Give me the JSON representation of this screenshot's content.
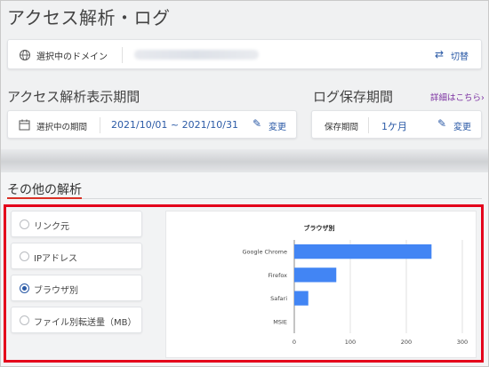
{
  "page": {
    "title": "アクセス解析・ログ"
  },
  "domain": {
    "label": "選択中のドメイン",
    "switch_label": "切替",
    "icon": "globe-icon"
  },
  "period": {
    "heading": "アクセス解析表示期間",
    "label": "選択中の期間",
    "value": "2021/10/01 ~ 2021/10/31",
    "edit_label": "変更"
  },
  "log": {
    "heading": "ログ保存期間",
    "detail_link": "詳細はこちら›",
    "label": "保存期間",
    "value": "1ケ月",
    "edit_label": "変更"
  },
  "other": {
    "heading": "その他の解析",
    "options": [
      {
        "label": "リンク元",
        "selected": false
      },
      {
        "label": "IPアドレス",
        "selected": false
      },
      {
        "label": "ブラウザ別",
        "selected": true
      },
      {
        "label": "ファイル別転送量（MB）",
        "selected": false
      }
    ]
  },
  "colors": {
    "accent": "#2b5aa6",
    "highlight": "#e4001b",
    "bar": "#4285f4"
  },
  "chart_data": {
    "type": "bar",
    "orientation": "horizontal",
    "title": "ブラウザ別",
    "categories": [
      "Google Chrome",
      "Firefox",
      "Safari",
      "MSIE"
    ],
    "values": [
      245,
      75,
      25,
      0
    ],
    "xlim": [
      0,
      300
    ],
    "xticks": [
      "0",
      "100",
      "200",
      "300"
    ],
    "grid": true
  }
}
